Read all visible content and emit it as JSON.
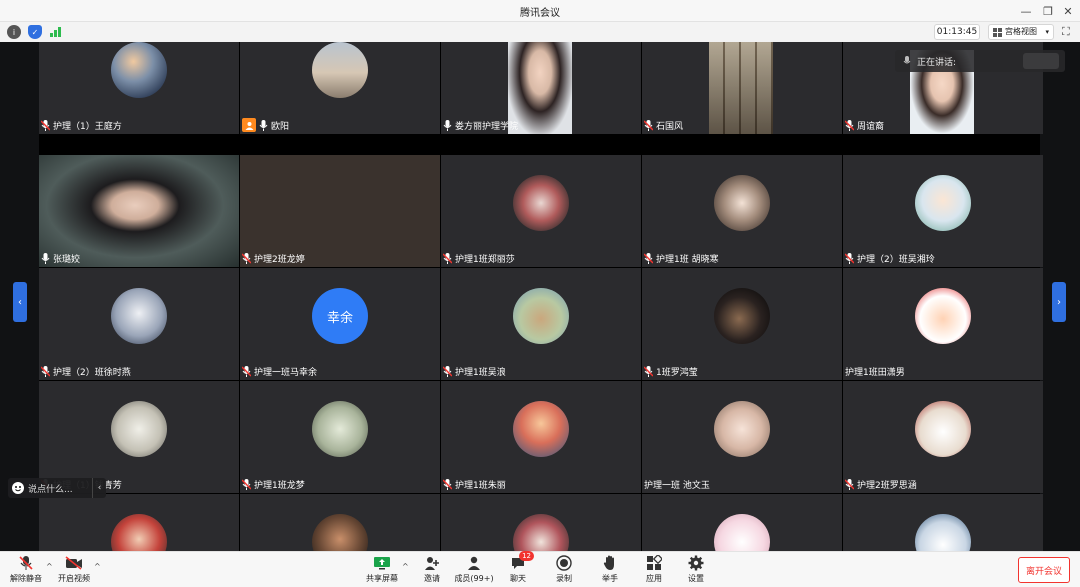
{
  "window": {
    "title": "腾讯会议",
    "minimize": "—",
    "restore": "❐",
    "close": "✕"
  },
  "toolbar": {
    "timer": "01:13:45",
    "view_label": "宫格视图",
    "view_caret": "▾",
    "fullscreen": "⛶",
    "info_icon": "i",
    "shield_icon": "✓"
  },
  "speaking_label": "正在讲话:",
  "chat": {
    "placeholder": "说点什么...",
    "collapse": "‹"
  },
  "nav": {
    "left": "‹",
    "right": "›"
  },
  "participants": [
    {
      "name": "护理（1）王庭方",
      "mic": "muted",
      "avatar": "photo-dusk"
    },
    {
      "name": "欧阳",
      "mic": "on",
      "host": true,
      "avatar": "photo-street"
    },
    {
      "name": "娄方丽护理学院",
      "mic": "on",
      "avatar": "video-woman"
    },
    {
      "name": "石国风",
      "mic": "muted",
      "avatar": "video-room"
    },
    {
      "name": "周谊裔",
      "mic": "muted",
      "avatar": "video-woman2"
    },
    {
      "name": "张璐姣",
      "mic": "on",
      "avatar": "video-glasses"
    },
    {
      "name": "护理2班龙婷",
      "mic": "muted",
      "avatar": "blank"
    },
    {
      "name": "护理1班郑丽莎",
      "mic": "muted",
      "avatar": "photo-collage"
    },
    {
      "name": "护理1班 胡晓寒",
      "mic": "muted",
      "avatar": "photo-girl"
    },
    {
      "name": "护理（2）班吴湘玲",
      "mic": "muted",
      "avatar": "photo-sunny"
    },
    {
      "name": "护理（2）班徐时燕",
      "mic": "muted",
      "avatar": "photo-anime"
    },
    {
      "name": "护理一班马幸余",
      "mic": "muted",
      "avatar": "letter",
      "letter": "幸余"
    },
    {
      "name": "护理1班吴浪",
      "mic": "muted",
      "avatar": "photo-rabbit"
    },
    {
      "name": "1班罗鸿莹",
      "mic": "muted",
      "avatar": "photo-dark"
    },
    {
      "name": "护理1班田潇男",
      "mic": "none",
      "avatar": "photo-cartoon"
    },
    {
      "name": "护理（1）钱青芳",
      "mic": "muted",
      "avatar": "photo-cat"
    },
    {
      "name": "护理1班龙梦",
      "mic": "muted",
      "avatar": "photo-boy"
    },
    {
      "name": "护理1班朱丽",
      "mic": "muted",
      "avatar": "photo-sunset"
    },
    {
      "name": "护理一班 池文玉",
      "mic": "none",
      "avatar": "photo-blonde"
    },
    {
      "name": "护理2班罗思涵",
      "mic": "muted",
      "avatar": "photo-bear"
    },
    {
      "name": "",
      "mic": "none",
      "avatar": "photo-redhair"
    },
    {
      "name": "",
      "mic": "none",
      "avatar": "photo-man"
    },
    {
      "name": "",
      "mic": "none",
      "avatar": "photo-paint"
    },
    {
      "name": "",
      "mic": "none",
      "avatar": "photo-pinkanime"
    },
    {
      "name": "",
      "mic": "none",
      "avatar": "photo-duck"
    }
  ],
  "bottombar": {
    "unmute": "解除静音",
    "start_video": "开启视频",
    "share_screen": "共享屏幕",
    "invite": "邀请",
    "members": "成员(99+)",
    "chat": "聊天",
    "chat_badge": "12",
    "record": "录制",
    "raise_hand": "举手",
    "apps": "应用",
    "settings": "设置",
    "leave": "离开会议",
    "caret": "^"
  },
  "colors": {
    "accent": "#2f6fe0",
    "danger": "#f2342f",
    "host": "#ff8a1f",
    "tile_bg": "#2b2b2e",
    "letter_avatar": "#2f7cf6"
  }
}
